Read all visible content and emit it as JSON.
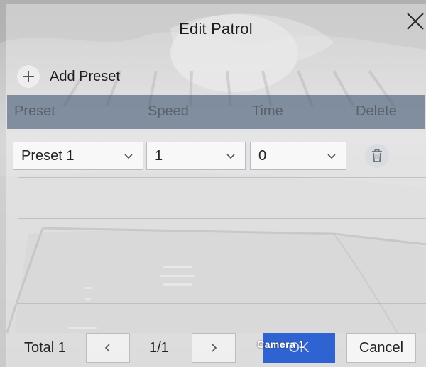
{
  "dialog": {
    "title": "Edit Patrol",
    "add_preset_label": "Add Preset"
  },
  "table": {
    "columns": [
      "Preset",
      "Speed",
      "Time",
      "Delete"
    ],
    "rows": [
      {
        "preset": "Preset 1",
        "speed": "1",
        "time": "0"
      }
    ]
  },
  "footer": {
    "total_label": "Total 1",
    "page_info": "1/1",
    "ok_label": "OK",
    "cancel_label": "Cancel"
  },
  "overlay": {
    "camera_label": "Camera 1"
  },
  "colors": {
    "header_band": "#465a78",
    "ok_button": "#2f63d2"
  },
  "icons": [
    "close-icon",
    "plus-icon",
    "chevron-down-icon",
    "trash-icon",
    "chevron-left-icon",
    "chevron-right-icon"
  ]
}
